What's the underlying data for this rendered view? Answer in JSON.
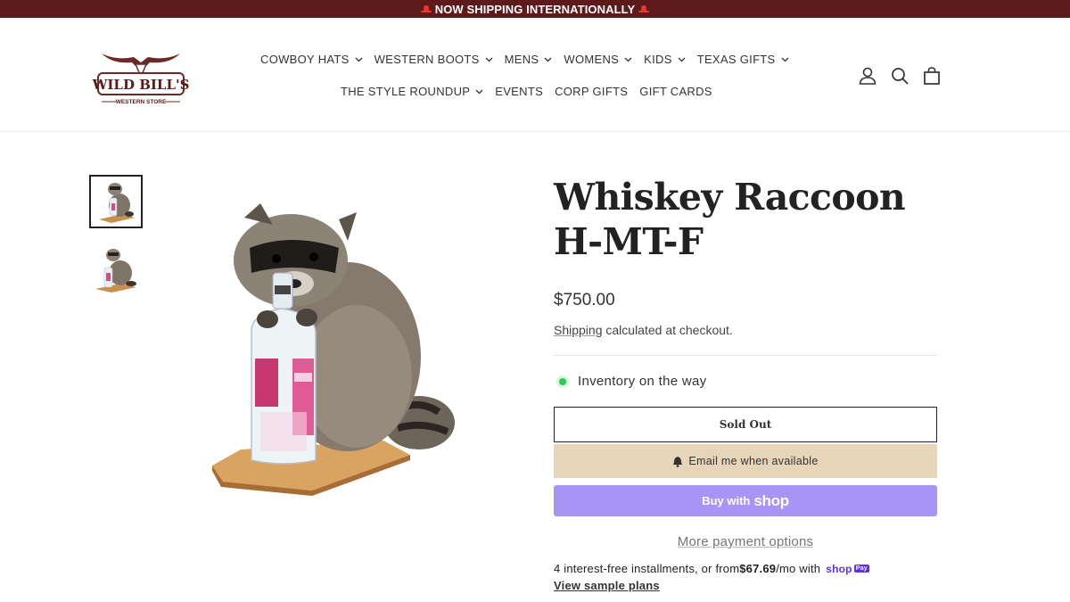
{
  "announcement": {
    "text": "NOW SHIPPING INTERNATIONALLY"
  },
  "brand": {
    "name": "WILD BILL'S",
    "tagline": "WESTERN STORE"
  },
  "nav": {
    "row1": [
      {
        "label": "COWBOY HATS",
        "dropdown": true
      },
      {
        "label": "WESTERN BOOTS",
        "dropdown": true
      },
      {
        "label": "MENS",
        "dropdown": true
      },
      {
        "label": "WOMENS",
        "dropdown": true
      },
      {
        "label": "KIDS",
        "dropdown": true
      },
      {
        "label": "TEXAS GIFTS",
        "dropdown": true
      }
    ],
    "row2": [
      {
        "label": "THE STYLE ROUNDUP",
        "dropdown": true
      },
      {
        "label": "EVENTS",
        "dropdown": false
      },
      {
        "label": "CORP GIFTS",
        "dropdown": false
      },
      {
        "label": "GIFT CARDS",
        "dropdown": false
      }
    ]
  },
  "header_icons": [
    "account-icon",
    "search-icon",
    "cart-icon"
  ],
  "product": {
    "title": "Whiskey Raccoon H-MT-F",
    "price": "$750.00",
    "shipping_link": "Shipping",
    "shipping_rest": " calculated at checkout.",
    "inventory": "Inventory on the way",
    "sold_out": "Sold Out",
    "email_me": "Email me when available",
    "buy_with": "Buy with",
    "shop_word": "shop",
    "more_payment": "More payment options",
    "installments_pre": "4 interest-free installments, or from ",
    "installments_amount": "$67.69",
    "installments_post": "/mo with ",
    "shoppay_word": "shop",
    "shoppay_pay": "Pay",
    "view_plans": "View sample plans"
  },
  "colors": {
    "announcement_bg": "#5e1a1b",
    "email_btn": "#e6d5b9",
    "shop_btn": "#a795f5",
    "inventory_dot": "#2ec95c",
    "shoppay": "#5a31f4"
  }
}
